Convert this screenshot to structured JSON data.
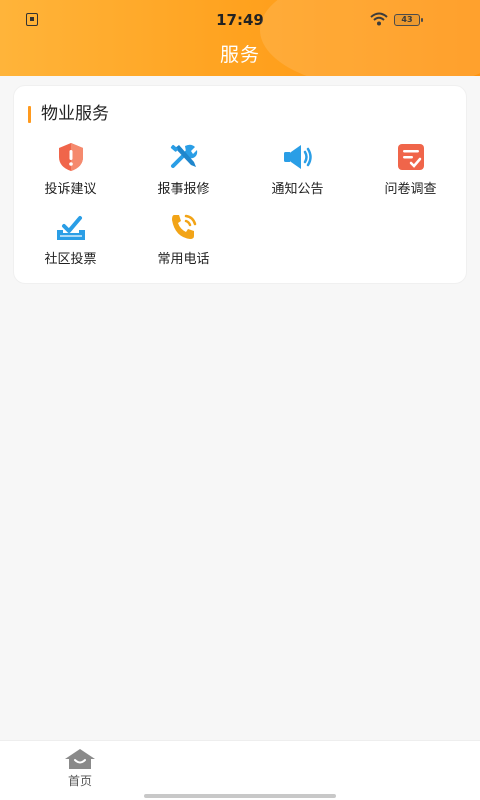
{
  "status_bar": {
    "time": "17:49",
    "battery": "43"
  },
  "header": {
    "title": "服务"
  },
  "property_services": {
    "title": "物业服务",
    "items": [
      {
        "label": "投诉建议",
        "icon": "shield-alert-icon",
        "color": "#f0654a"
      },
      {
        "label": "报事报修",
        "icon": "tools-icon",
        "color": "#2a9ee6"
      },
      {
        "label": "通知公告",
        "icon": "speaker-icon",
        "color": "#2a9ee6"
      },
      {
        "label": "问卷调查",
        "icon": "survey-icon",
        "color": "#f0654a"
      },
      {
        "label": "社区投票",
        "icon": "ballot-box-icon",
        "color": "#2a9ee6"
      },
      {
        "label": "常用电话",
        "icon": "phone-icon",
        "color": "#f2a417"
      }
    ]
  },
  "tabbar": {
    "home_label": "首页"
  },
  "colors": {
    "accent": "#ff9a1e",
    "header_start": "#ffb43a",
    "header_end": "#ff9410"
  }
}
